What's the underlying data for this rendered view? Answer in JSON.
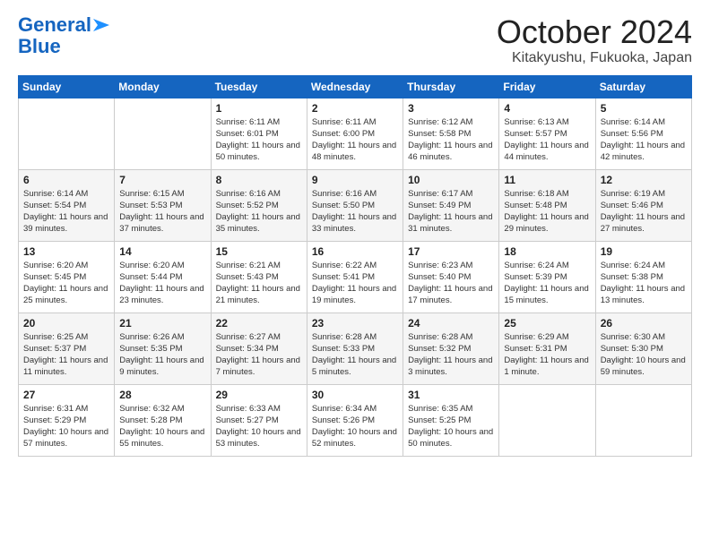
{
  "header": {
    "logo_line1": "General",
    "logo_line2": "Blue",
    "month": "October 2024",
    "location": "Kitakyushu, Fukuoka, Japan"
  },
  "days_of_week": [
    "Sunday",
    "Monday",
    "Tuesday",
    "Wednesday",
    "Thursday",
    "Friday",
    "Saturday"
  ],
  "weeks": [
    [
      {
        "day": "",
        "content": ""
      },
      {
        "day": "",
        "content": ""
      },
      {
        "day": "1",
        "content": "Sunrise: 6:11 AM\nSunset: 6:01 PM\nDaylight: 11 hours and 50 minutes."
      },
      {
        "day": "2",
        "content": "Sunrise: 6:11 AM\nSunset: 6:00 PM\nDaylight: 11 hours and 48 minutes."
      },
      {
        "day": "3",
        "content": "Sunrise: 6:12 AM\nSunset: 5:58 PM\nDaylight: 11 hours and 46 minutes."
      },
      {
        "day": "4",
        "content": "Sunrise: 6:13 AM\nSunset: 5:57 PM\nDaylight: 11 hours and 44 minutes."
      },
      {
        "day": "5",
        "content": "Sunrise: 6:14 AM\nSunset: 5:56 PM\nDaylight: 11 hours and 42 minutes."
      }
    ],
    [
      {
        "day": "6",
        "content": "Sunrise: 6:14 AM\nSunset: 5:54 PM\nDaylight: 11 hours and 39 minutes."
      },
      {
        "day": "7",
        "content": "Sunrise: 6:15 AM\nSunset: 5:53 PM\nDaylight: 11 hours and 37 minutes."
      },
      {
        "day": "8",
        "content": "Sunrise: 6:16 AM\nSunset: 5:52 PM\nDaylight: 11 hours and 35 minutes."
      },
      {
        "day": "9",
        "content": "Sunrise: 6:16 AM\nSunset: 5:50 PM\nDaylight: 11 hours and 33 minutes."
      },
      {
        "day": "10",
        "content": "Sunrise: 6:17 AM\nSunset: 5:49 PM\nDaylight: 11 hours and 31 minutes."
      },
      {
        "day": "11",
        "content": "Sunrise: 6:18 AM\nSunset: 5:48 PM\nDaylight: 11 hours and 29 minutes."
      },
      {
        "day": "12",
        "content": "Sunrise: 6:19 AM\nSunset: 5:46 PM\nDaylight: 11 hours and 27 minutes."
      }
    ],
    [
      {
        "day": "13",
        "content": "Sunrise: 6:20 AM\nSunset: 5:45 PM\nDaylight: 11 hours and 25 minutes."
      },
      {
        "day": "14",
        "content": "Sunrise: 6:20 AM\nSunset: 5:44 PM\nDaylight: 11 hours and 23 minutes."
      },
      {
        "day": "15",
        "content": "Sunrise: 6:21 AM\nSunset: 5:43 PM\nDaylight: 11 hours and 21 minutes."
      },
      {
        "day": "16",
        "content": "Sunrise: 6:22 AM\nSunset: 5:41 PM\nDaylight: 11 hours and 19 minutes."
      },
      {
        "day": "17",
        "content": "Sunrise: 6:23 AM\nSunset: 5:40 PM\nDaylight: 11 hours and 17 minutes."
      },
      {
        "day": "18",
        "content": "Sunrise: 6:24 AM\nSunset: 5:39 PM\nDaylight: 11 hours and 15 minutes."
      },
      {
        "day": "19",
        "content": "Sunrise: 6:24 AM\nSunset: 5:38 PM\nDaylight: 11 hours and 13 minutes."
      }
    ],
    [
      {
        "day": "20",
        "content": "Sunrise: 6:25 AM\nSunset: 5:37 PM\nDaylight: 11 hours and 11 minutes."
      },
      {
        "day": "21",
        "content": "Sunrise: 6:26 AM\nSunset: 5:35 PM\nDaylight: 11 hours and 9 minutes."
      },
      {
        "day": "22",
        "content": "Sunrise: 6:27 AM\nSunset: 5:34 PM\nDaylight: 11 hours and 7 minutes."
      },
      {
        "day": "23",
        "content": "Sunrise: 6:28 AM\nSunset: 5:33 PM\nDaylight: 11 hours and 5 minutes."
      },
      {
        "day": "24",
        "content": "Sunrise: 6:28 AM\nSunset: 5:32 PM\nDaylight: 11 hours and 3 minutes."
      },
      {
        "day": "25",
        "content": "Sunrise: 6:29 AM\nSunset: 5:31 PM\nDaylight: 11 hours and 1 minute."
      },
      {
        "day": "26",
        "content": "Sunrise: 6:30 AM\nSunset: 5:30 PM\nDaylight: 10 hours and 59 minutes."
      }
    ],
    [
      {
        "day": "27",
        "content": "Sunrise: 6:31 AM\nSunset: 5:29 PM\nDaylight: 10 hours and 57 minutes."
      },
      {
        "day": "28",
        "content": "Sunrise: 6:32 AM\nSunset: 5:28 PM\nDaylight: 10 hours and 55 minutes."
      },
      {
        "day": "29",
        "content": "Sunrise: 6:33 AM\nSunset: 5:27 PM\nDaylight: 10 hours and 53 minutes."
      },
      {
        "day": "30",
        "content": "Sunrise: 6:34 AM\nSunset: 5:26 PM\nDaylight: 10 hours and 52 minutes."
      },
      {
        "day": "31",
        "content": "Sunrise: 6:35 AM\nSunset: 5:25 PM\nDaylight: 10 hours and 50 minutes."
      },
      {
        "day": "",
        "content": ""
      },
      {
        "day": "",
        "content": ""
      }
    ]
  ]
}
